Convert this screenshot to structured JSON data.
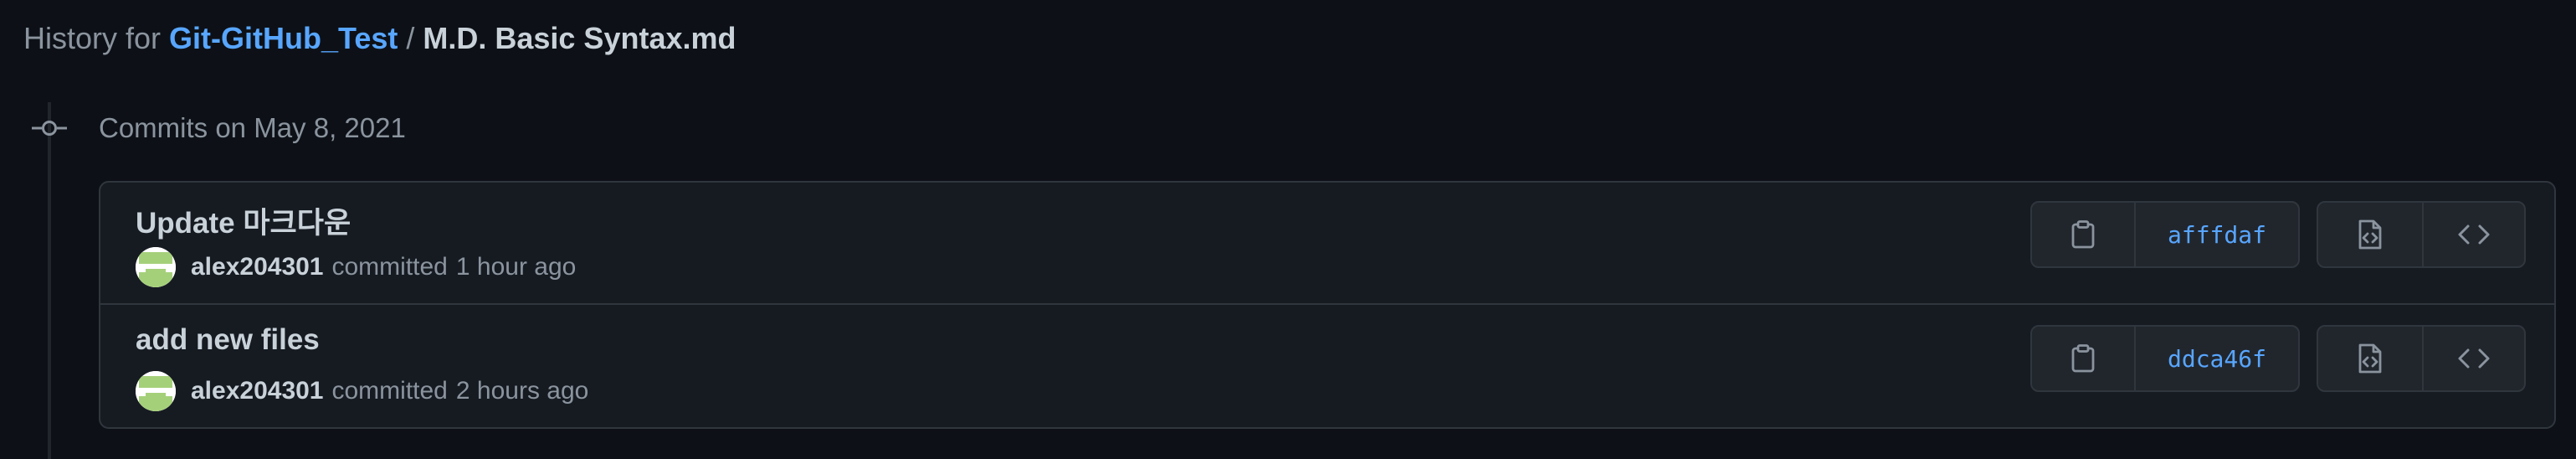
{
  "header": {
    "prefix": "History for",
    "repo": "Git-GitHub_Test",
    "separator": "/",
    "file": "M.D. Basic Syntax.md"
  },
  "commits_heading": "Commits on May 8, 2021",
  "commits": [
    {
      "message": "Update 마크다운",
      "author": "alex204301",
      "action": "committed",
      "time": "1 hour ago",
      "sha": "afffdaf"
    },
    {
      "message": "add new files",
      "author": "alex204301",
      "action": "committed",
      "time": "2 hours ago",
      "sha": "ddca46f"
    }
  ],
  "colors": {
    "background": "#0d1117",
    "panel": "#161b22",
    "border": "#30363d",
    "link": "#58a6ff",
    "muted": "#8b949e",
    "text": "#c9d1d9",
    "avatar_green": "#a5d07a"
  },
  "icons": {
    "commit_dot": "git-commit-icon",
    "copy": "clipboard-icon",
    "view_file": "file-code-icon",
    "browse": "code-icon"
  }
}
